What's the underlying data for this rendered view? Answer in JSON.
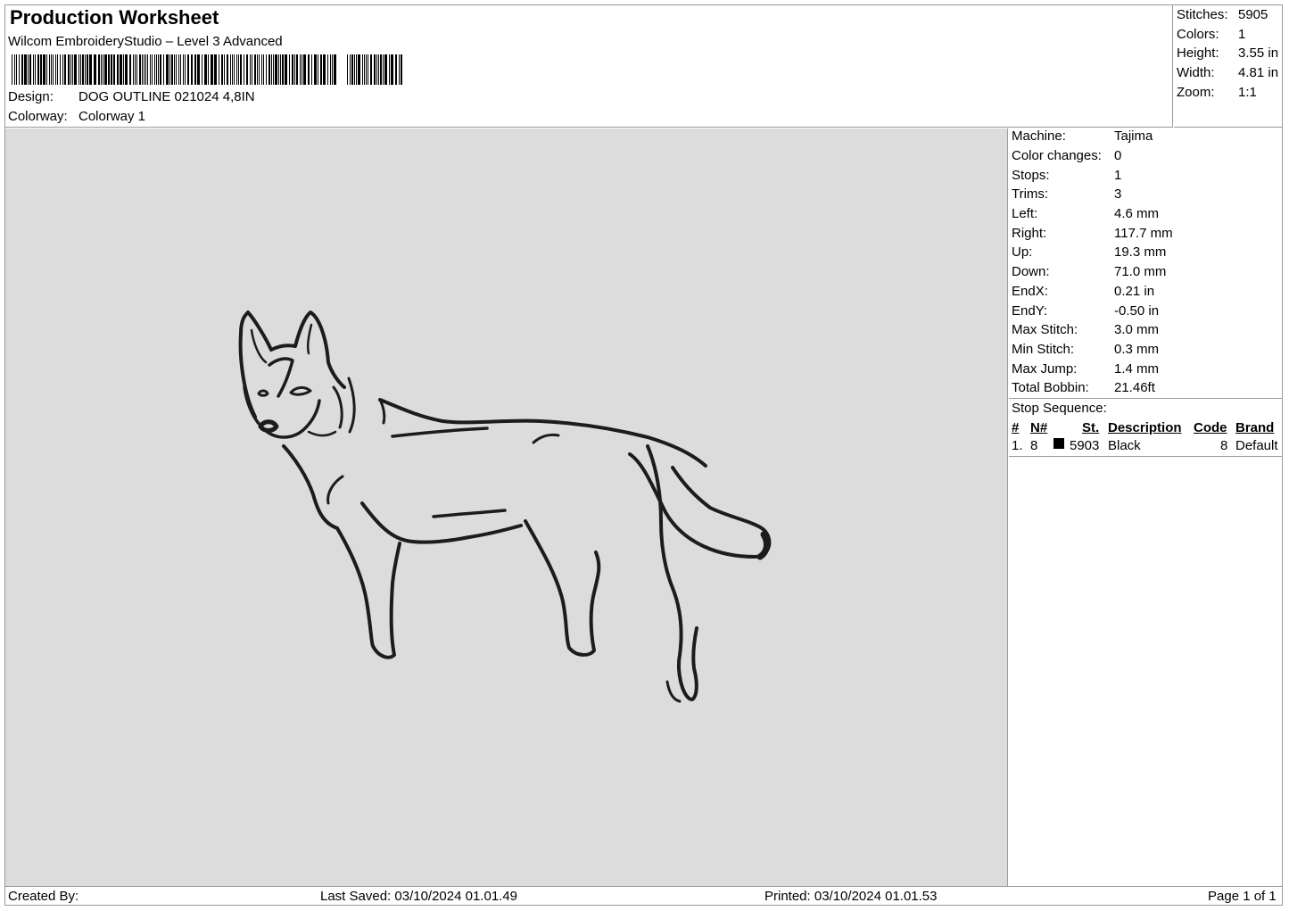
{
  "header": {
    "title": "Production Worksheet",
    "software": "Wilcom EmbroideryStudio – Level 3 Advanced",
    "design_label": "Design:",
    "design_value": "DOG OUTLINE 021024 4,8IN",
    "colorway_label": "Colorway:",
    "colorway_value": "Colorway 1"
  },
  "summary": [
    {
      "label": "Stitches:",
      "value": "5905"
    },
    {
      "label": "Colors:",
      "value": "1"
    },
    {
      "label": "Height:",
      "value": "3.55 in"
    },
    {
      "label": "Width:",
      "value": "4.81 in"
    },
    {
      "label": "Zoom:",
      "value": "1:1"
    }
  ],
  "machine_info": [
    {
      "label": "Machine:",
      "value": "Tajima"
    },
    {
      "label": "Color changes:",
      "value": "0"
    },
    {
      "label": "Stops:",
      "value": "1"
    },
    {
      "label": "Trims:",
      "value": "3"
    },
    {
      "label": "Left:",
      "value": "4.6 mm"
    },
    {
      "label": "Right:",
      "value": "117.7 mm"
    },
    {
      "label": "Up:",
      "value": "19.3 mm"
    },
    {
      "label": "Down:",
      "value": "71.0 mm"
    },
    {
      "label": "EndX:",
      "value": "0.21 in"
    },
    {
      "label": "EndY:",
      "value": "-0.50 in"
    },
    {
      "label": "Max Stitch:",
      "value": "3.0 mm"
    },
    {
      "label": "Min Stitch:",
      "value": "0.3 mm"
    },
    {
      "label": "Max Jump:",
      "value": "1.4 mm"
    },
    {
      "label": "Total Bobbin:",
      "value": "21.46ft"
    }
  ],
  "stop_sequence": {
    "title": "Stop Sequence:",
    "headers": {
      "num": "#",
      "needle": "N#",
      "stitches": "St.",
      "description": "Description",
      "code": "Code",
      "brand": "Brand"
    },
    "rows": [
      {
        "num": "1.",
        "needle": "8",
        "color": "#000000",
        "stitches": "5903",
        "description": "Black",
        "code": "8",
        "brand": "Default"
      }
    ]
  },
  "footer": {
    "created_by": "Created By:",
    "last_saved": "Last Saved: 03/10/2024 01.01.49",
    "printed": "Printed: 03/10/2024 01.01.53",
    "page": "Page 1 of 1"
  },
  "colors": {
    "canvas_bg": "#dcdcdc",
    "thread": "#1c1c1c"
  }
}
